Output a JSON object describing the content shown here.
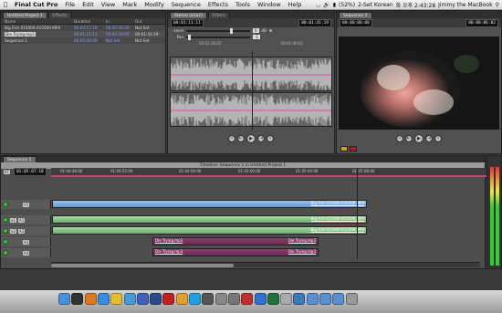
{
  "menubar": {
    "apple": "",
    "app": "Final Cut Pro",
    "items": [
      "File",
      "Edit",
      "View",
      "Mark",
      "Modify",
      "Sequence",
      "Effects",
      "Tools",
      "Window",
      "Help"
    ],
    "battery": "(52%)",
    "input": "2-Set Korean",
    "clock": "화 오후 2:43:28",
    "user": "Jimmy the MacBook"
  },
  "browser": {
    "tab": "Untitled Project 1",
    "tab2": "Effects",
    "columns": [
      "Name",
      "Duration",
      "In",
      "Out"
    ],
    "rows": [
      {
        "name": "Big Fish 015000-015500.MP4",
        "duration": "00:04:15:18",
        "in": "00:00:26:20",
        "out": "Not Set"
      },
      {
        "name": "Die Trying.mp3",
        "duration": "00:01:11:11",
        "in": "00:00:30:05",
        "out": "00:01:41:19"
      },
      {
        "name": "Sequence 1",
        "duration": "00:00:08:08",
        "in": "Not Set",
        "out": "Not Set"
      }
    ]
  },
  "viewer": {
    "tab": "Stereo (a1a2)",
    "tab2": "Filters",
    "tc_left": "00:01:11:11",
    "tc_right": "00:01:41:19",
    "level_label": "Level",
    "level_value": "0",
    "level_unit": "dB",
    "pan_label": "Pan",
    "pan_value": "-1",
    "ruler_a": "00:01:36:02",
    "ruler_b": "00:01:40:02"
  },
  "canvas": {
    "tab": "Sequence 1",
    "tc_left": "00:00:08:08",
    "tc_right": "00:00:06:02"
  },
  "timeline": {
    "tab": "Sequence 1",
    "title": "Timeline: Sequence 1 in Untitled Project 1",
    "rt": "RT",
    "current_tc": "01:05:07:18",
    "ruler": [
      "01:04:48:00",
      "01:04:52:00",
      "01:04:56:00",
      "01:05:00:00",
      "01:05:04:00",
      "01:05:08:00"
    ],
    "tracks": [
      {
        "name": "V1",
        "patch": ""
      },
      {
        "name": "A1",
        "patch": "a1"
      },
      {
        "name": "A2",
        "patch": "a2"
      },
      {
        "name": "A3",
        "patch": ""
      },
      {
        "name": "A4",
        "patch": ""
      }
    ],
    "clip_video": "Big Fish 015000-015500.MP4",
    "clip_a1": "Big Fish 015000-015500.MP4",
    "clip_a2": "Big Fish 015000-015500.MP4",
    "clip_a3_left": "Die Trying.mp3",
    "clip_a3_right": "Die Trying.mp3",
    "clip_a4_left": "Die Trying.mp3",
    "clip_a4_right": "Die Trying.mp3"
  },
  "dock": {
    "icons": [
      "finder-icon",
      "dashboard-icon",
      "firefox-icon",
      "safari-icon",
      "chrome-icon",
      "mail-icon",
      "itunes-icon",
      "photoshop-icon",
      "acrobat-icon",
      "illustrator-icon",
      "skype-icon",
      "final-cut-icon",
      "compressor-icon",
      "system-preferences-icon",
      "calendar-icon",
      "app-store-icon",
      "ftp-icon",
      "text-edit-icon",
      "preview-icon",
      "folder-icon",
      "folder-icon",
      "downloads-icon",
      "trash-icon"
    ]
  },
  "colors": {
    "accent": "#7ea0ff",
    "video_clip": "#7aa6da",
    "audio_clip": "#88c488",
    "music_clip": "#7a3460"
  }
}
